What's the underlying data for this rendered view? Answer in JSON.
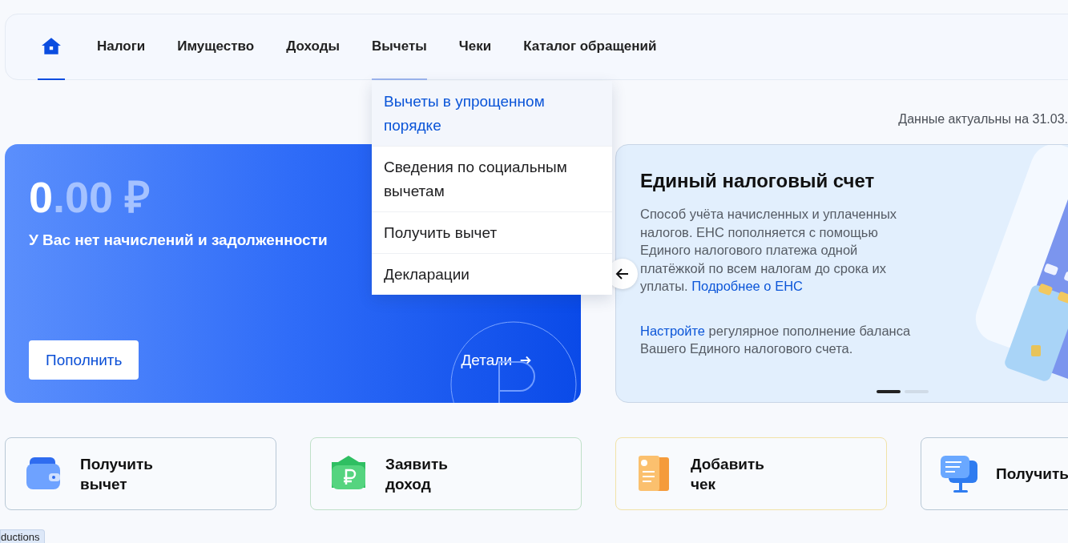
{
  "nav": {
    "items": [
      {
        "kind": "home",
        "selected": true,
        "expanded": false
      },
      {
        "kind": "tab",
        "label": "Налоги",
        "selected": false,
        "expanded": false
      },
      {
        "kind": "tab",
        "label": "Имущество",
        "selected": false,
        "expanded": false
      },
      {
        "kind": "tab",
        "label": "Доходы",
        "selected": false,
        "expanded": false
      },
      {
        "kind": "tab",
        "label": "Вычеты",
        "selected": false,
        "expanded": true,
        "menu": [
          {
            "label": "Вычеты в упрощенном порядке",
            "selected": true
          },
          {
            "label": "Сведения по социальным вычетам",
            "selected": false
          },
          {
            "label": "Получить вычет",
            "selected": false
          },
          {
            "label": "Декларации",
            "selected": false
          }
        ]
      },
      {
        "kind": "tab",
        "label": "Чеки",
        "selected": false,
        "expanded": false
      },
      {
        "kind": "tab",
        "label": "Каталог обращений",
        "selected": false,
        "expanded": false
      }
    ]
  },
  "data_date": "Данные актуальны на 31.03.",
  "balance_card": {
    "amount_integer": "0",
    "amount_fraction": ".00 ₽",
    "subtitle": "У Вас нет начислений и задолженности",
    "button": "Пополнить",
    "details_link": "Детали"
  },
  "ens_card": {
    "title": "Единый налоговый счет",
    "text": "Способ учёта начисленных и уплаченных налогов. ЕНС пополняется с помощью Единого налогового платежа одной платёжкой по всем налогам до срока их уплаты.",
    "text_link": "Подробнее о ЕНС",
    "setup_link": "Настройте",
    "setup_text": "регулярное пополнение баланса Вашего Единого налогового счета.",
    "dots": [
      {
        "selected": true
      },
      {
        "selected": false
      }
    ]
  },
  "actions": [
    {
      "kind": "wallet",
      "label": "Получить вычет"
    },
    {
      "kind": "income",
      "label": "Заявить доход"
    },
    {
      "kind": "receipt",
      "label": "Добавить чек"
    },
    {
      "kind": "chat",
      "label": "Получить"
    }
  ],
  "tooltip": "ductions"
}
